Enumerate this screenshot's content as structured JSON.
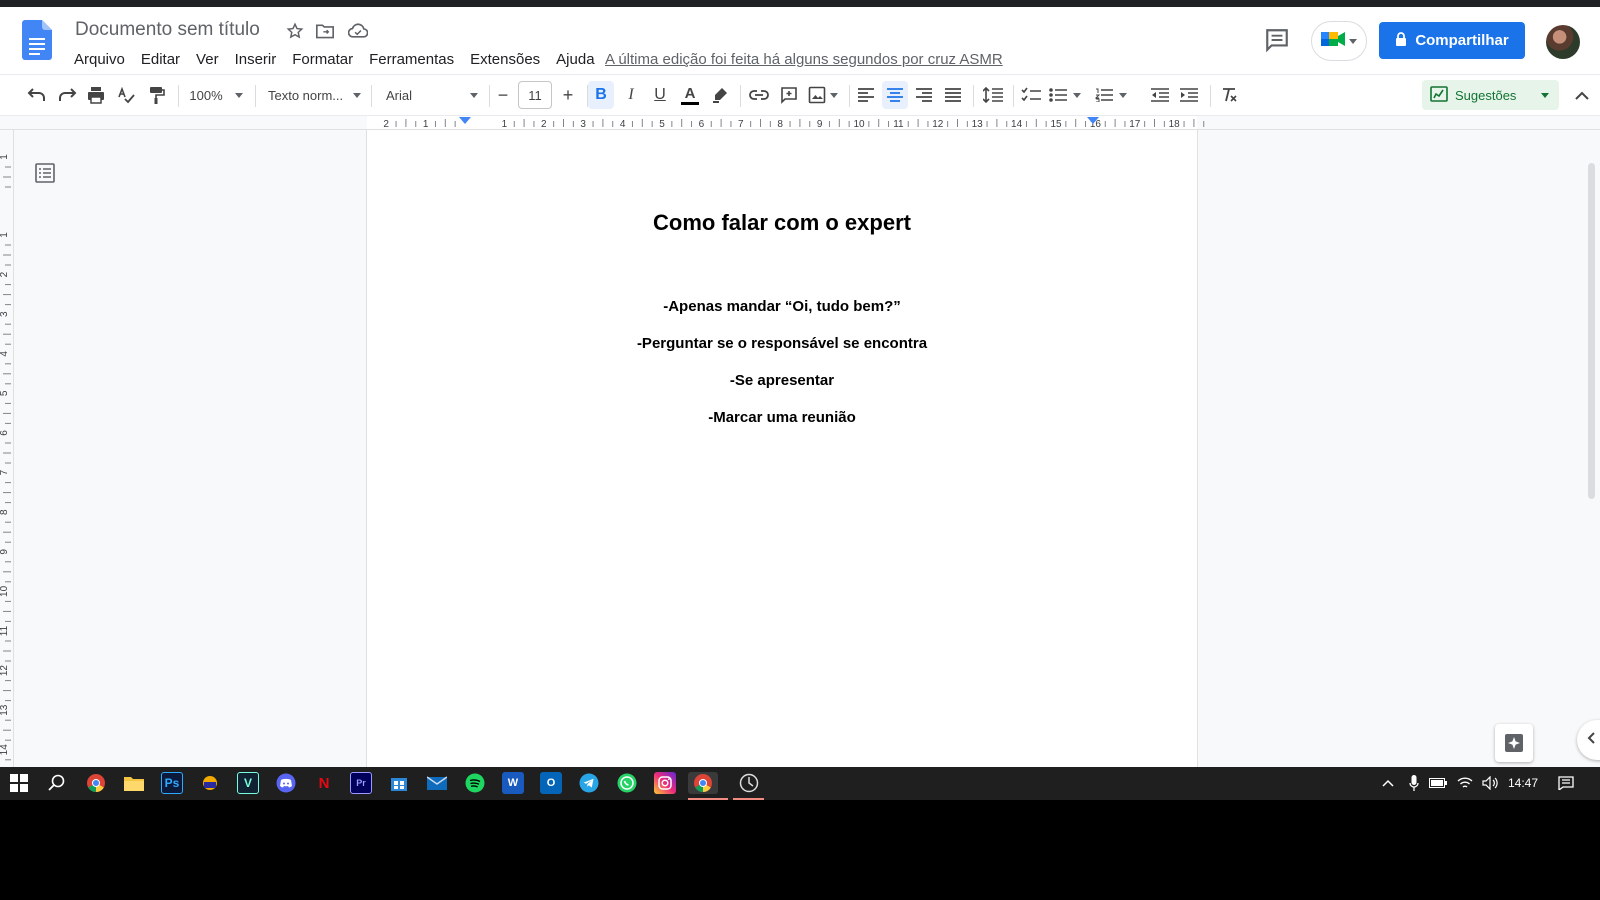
{
  "doc": {
    "title": "Documento sem título",
    "last_edit": "A última edição foi feita há alguns segundos por cruz ASMR"
  },
  "menu": [
    "Arquivo",
    "Editar",
    "Ver",
    "Inserir",
    "Formatar",
    "Ferramentas",
    "Extensões",
    "Ajuda"
  ],
  "header": {
    "share_label": "Compartilhar",
    "icons": [
      "docs-logo-icon",
      "star-icon",
      "move-folder-icon",
      "cloud-status-icon",
      "comments-icon",
      "meet-icon",
      "lock-icon",
      "avatar"
    ]
  },
  "toolbar": {
    "zoom": "100%",
    "style": "Texto norm...",
    "font": "Arial",
    "font_size": "11",
    "suggestions_label": "Sugestões",
    "active_states": [
      "bold",
      "align-center"
    ]
  },
  "ruler": {
    "h_labels": [
      "2",
      "1",
      "1",
      "2",
      "3",
      "4",
      "5",
      "6",
      "7",
      "8",
      "9",
      "10",
      "11",
      "12",
      "13",
      "14",
      "15",
      "16",
      "17",
      "18"
    ],
    "v_labels": [
      "1",
      "1",
      "2",
      "3",
      "4",
      "5",
      "6",
      "7",
      "8",
      "9",
      "10",
      "11",
      "12",
      "13",
      "14"
    ]
  },
  "content": {
    "heading": "Como falar com o expert",
    "lines": [
      "-Apenas mandar “Oi, tudo bem?”",
      "-Perguntar se o responsável se encontra",
      "-Se apresentar",
      "-Marcar uma reunião"
    ]
  },
  "taskbar": {
    "time": "14:47",
    "apps": [
      "windows-start",
      "search",
      "chrome",
      "file-explorer",
      "photoshop",
      "app",
      "vegas",
      "discord",
      "netflix",
      "premiere",
      "store",
      "mail",
      "spotify",
      "word",
      "outlook",
      "telegram",
      "whatsapp",
      "instagram",
      "chrome-active",
      "clock-app"
    ]
  },
  "colors": {
    "share_blue": "#1a73e8",
    "suggest_green": "#137333",
    "toolbar_active": "#e8f0fe",
    "taskbar": "#1f1f1f"
  }
}
